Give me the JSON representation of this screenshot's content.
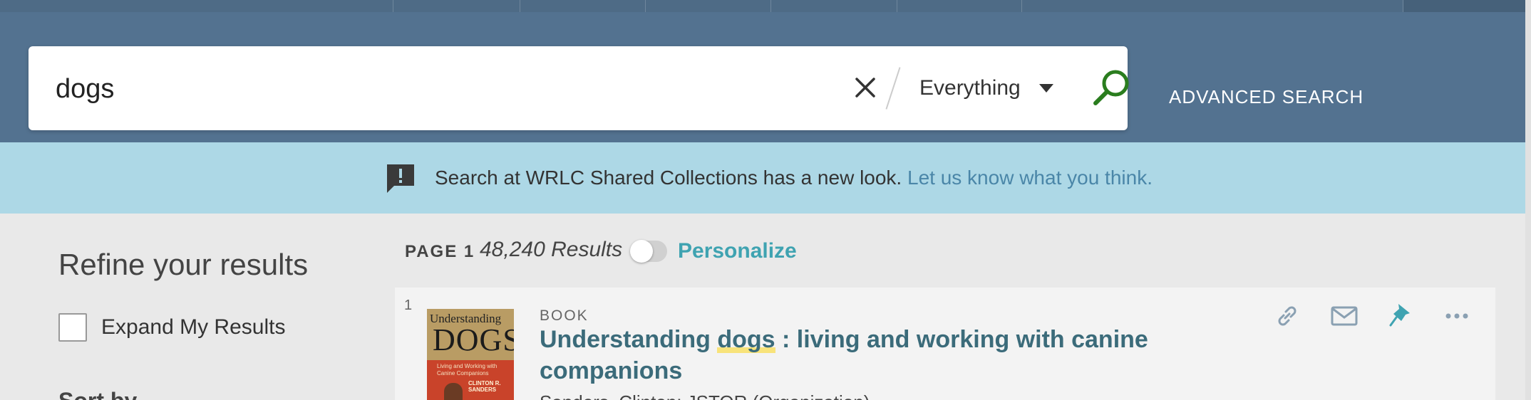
{
  "search": {
    "query": "dogs",
    "scope": "Everything",
    "advanced_label": "ADVANCED SEARCH"
  },
  "notice": {
    "text": "Search at WRLC Shared Collections has a new look.",
    "link_text": "Let us know what you think."
  },
  "sidebar": {
    "title": "Refine your results",
    "expand_label": "Expand My Results",
    "sort_label": "Sort by"
  },
  "results_header": {
    "page_label": "PAGE 1",
    "count_text": "48,240 Results",
    "personalize_label": "Personalize",
    "personalize_on": false
  },
  "results": [
    {
      "index": "1",
      "type": "BOOK",
      "title_before": "Understanding ",
      "title_highlight": "dogs",
      "title_after": " : living and working with canine companions",
      "meta": "Sanders, Clinton; JSTOR (Organization)",
      "cover": {
        "word1": "Understanding",
        "word2": "DOGS",
        "subtitle": "Living and Working with Canine Companions",
        "author": "CLINTON R. SANDERS"
      }
    }
  ],
  "colors": {
    "header_bg": "#537290",
    "notice_bg": "#add8e6",
    "search_icon": "#2a7d1e",
    "accent_link": "#3b6b7a",
    "personalize": "#3fa3b1",
    "highlight": "#f8e37a",
    "pin": "#3fa3b1"
  },
  "icons": {
    "clear": "close-icon",
    "scope_caret": "caret-down-icon",
    "search": "search-icon",
    "notice": "alert-chat-icon",
    "permalink": "link-icon",
    "email": "mail-icon",
    "pin": "pin-icon",
    "more": "more-icon"
  }
}
